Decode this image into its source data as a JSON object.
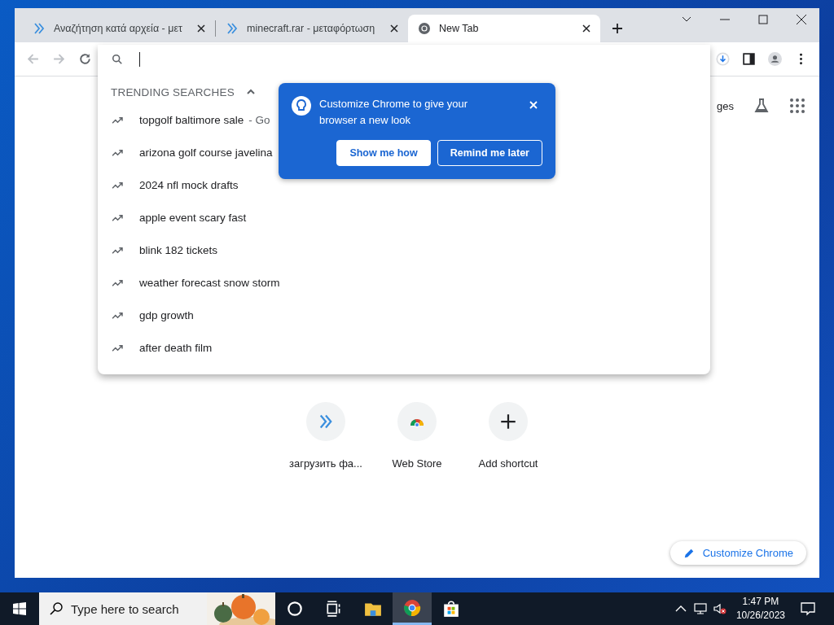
{
  "browser": {
    "tabs": [
      {
        "title": "Αναζήτηση κατά αρχεία - μετ",
        "kind": "chevrons",
        "selected": false
      },
      {
        "title": "minecraft.rar - μεταφόρτωση",
        "kind": "chevrons",
        "selected": false
      },
      {
        "title": "New Tab",
        "kind": "chrome",
        "selected": true
      }
    ],
    "dropdown": {
      "section_title": "TRENDING SEARCHES",
      "expanded": true,
      "suggestions": [
        {
          "text": "topgolf baltimore sale",
          "suffix": "- Go"
        },
        {
          "text": "arizona golf course javelina"
        },
        {
          "text": "2024 nfl mock drafts"
        },
        {
          "text": "apple event scary fast"
        },
        {
          "text": "blink 182 tickets"
        },
        {
          "text": "weather forecast snow storm"
        },
        {
          "text": "gdp growth"
        },
        {
          "text": "after death film"
        }
      ]
    },
    "promo": {
      "title": "Customize Chrome to give your browser a new look",
      "buttons": [
        {
          "label": "Show me how",
          "kind": "filled"
        },
        {
          "label": "Remind me later",
          "kind": "outline"
        }
      ]
    },
    "header_link": "ges",
    "shortcuts": [
      {
        "label": "загрузить фа...",
        "kind": "chevrons"
      },
      {
        "label": "Web Store",
        "kind": "store"
      },
      {
        "label": "Add shortcut",
        "kind": "plus"
      }
    ],
    "customize_button": "Customize Chrome"
  },
  "taskbar": {
    "search_placeholder": "Type here to search",
    "apps": [
      {
        "kind": "cortana",
        "active": false
      },
      {
        "kind": "taskview",
        "active": false
      },
      {
        "kind": "explorer",
        "active": false
      },
      {
        "kind": "chrome",
        "active": true
      },
      {
        "kind": "store",
        "active": false
      }
    ],
    "time": "1:47 PM",
    "date": "10/26/2023"
  }
}
